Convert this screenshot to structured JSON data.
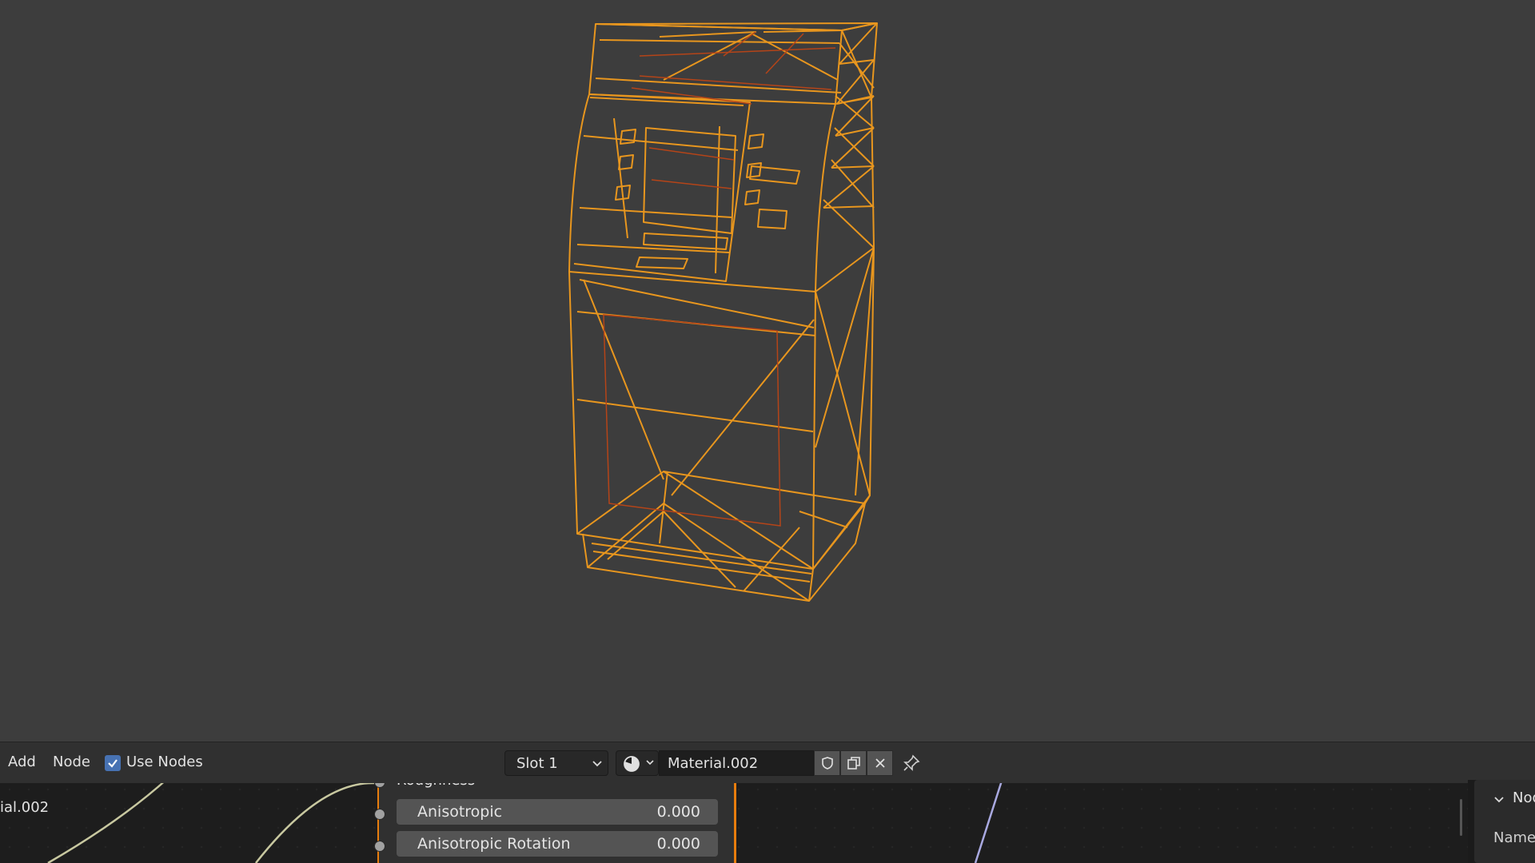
{
  "header": {
    "menu_add": "Add",
    "menu_node": "Node",
    "use_nodes_label": "Use Nodes",
    "use_nodes_checked": true,
    "slot_label": "Slot 1",
    "material_name": "Material.002"
  },
  "node": {
    "roughness_label": "Roughness",
    "fields": [
      {
        "label": "Anisotropic",
        "value": "0.000"
      },
      {
        "label": "Anisotropic Rotation",
        "value": "0.000"
      }
    ]
  },
  "left_node": {
    "label_fragment": "ial.002"
  },
  "sidebar": {
    "title_fragment": "Nod",
    "name_label": "Name:"
  },
  "colors": {
    "selection": "#e8961e",
    "inner_edge": "#b54418",
    "accent": "#4772b3",
    "node_edge": "#e87d0d"
  },
  "icons": [
    "checkbox-icon",
    "chevron-down-icon",
    "material-sphere-icon",
    "fake-user-shield-icon",
    "duplicate-icon",
    "close-icon",
    "pin-icon",
    "collapse-arrow-icon"
  ]
}
